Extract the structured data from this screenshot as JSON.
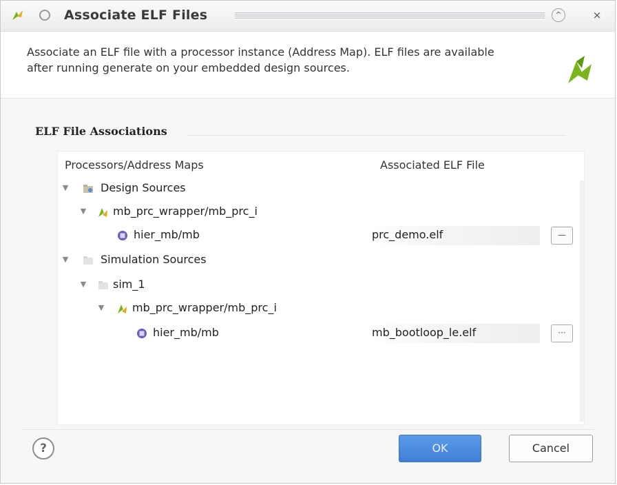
{
  "window": {
    "title": "Associate ELF Files",
    "maximize_glyph": "^",
    "close_glyph": "×"
  },
  "header": {
    "description": "Associate an ELF file with a processor instance (Address Map). ELF files are available after running generate on your embedded design sources."
  },
  "section": {
    "title": "ELF File Associations"
  },
  "table": {
    "columns": [
      "Processors/Address Maps",
      "Associated ELF File"
    ],
    "rows": [
      {
        "label": "Design Sources",
        "icon": "folder-design-icon"
      },
      {
        "label": "mb_prc_wrapper/mb_prc_i",
        "icon": "block-design-icon"
      },
      {
        "label": "hier_mb/mb",
        "icon": "processor-icon",
        "elf": "prc_demo.elf",
        "browse": "—"
      },
      {
        "label": "Simulation Sources",
        "icon": "folder-sim-icon"
      },
      {
        "label": "sim_1",
        "icon": "folder-sim-icon"
      },
      {
        "label": "mb_prc_wrapper/mb_prc_i",
        "icon": "block-design-icon"
      },
      {
        "label": "hier_mb/mb",
        "icon": "processor-icon",
        "elf": "mb_bootloop_le.elf",
        "browse": "···"
      }
    ]
  },
  "footer": {
    "help": "?",
    "ok": "OK",
    "cancel": "Cancel"
  },
  "colors": {
    "accent": "#4a89dc",
    "brand_green": "#7ab51d"
  }
}
